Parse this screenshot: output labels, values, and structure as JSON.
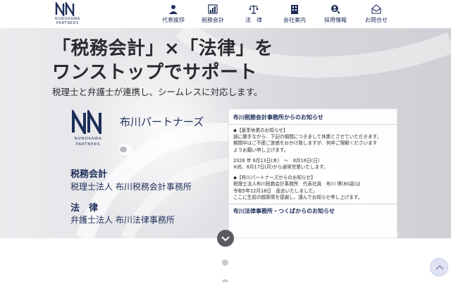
{
  "header": {
    "logo_line1": "NUNOKAWA",
    "logo_line2": "PARTNERS",
    "nav": [
      {
        "label": "代表挨拶",
        "icon": "person-icon"
      },
      {
        "label": "税務会計",
        "icon": "chart-icon"
      },
      {
        "label": "法　律",
        "icon": "scales-icon"
      },
      {
        "label": "会社案内",
        "icon": "building-icon"
      },
      {
        "label": "採用情報",
        "icon": "search-person-icon"
      },
      {
        "label": "お問合せ",
        "icon": "mail-icon"
      }
    ]
  },
  "hero": {
    "headline_line1": "「税務会計」×「法律」を",
    "headline_line2": "ワンストップでサポート",
    "subhead": "税理士と弁護士が連携し、シームレスに対応します。",
    "brand_name": "布川パートナーズ",
    "brand_logo_line1": "NUNOKAWA",
    "brand_logo_line2": "PARTNERS",
    "sections": [
      {
        "title": "税務会計",
        "sub": "税理士法人 布川税務会計事務所"
      },
      {
        "title": "法　律",
        "sub": "弁護士法人 布川法律事務所"
      }
    ]
  },
  "notice": {
    "heading": "布川税務会計事務所からのお知らせ",
    "item1_title": "◆【夏季休業のお知らせ】",
    "item1_lines": [
      "誠に勝手ながら、下記の期間につきまして休業とさせていただきます。",
      "期間中はご不便ご迷惑をおかけ致しますが、何卒ご理解くださいます",
      "ようお願い申し上げます。"
    ],
    "item1_dates": "2026 年 8月13日(木)　～　8月16日(日)",
    "item1_note": "※尚、8月17日(月)から通常営業いたします。",
    "item2_title": "◆【布川パートナーズからのお知らせ】",
    "item2_lines": [
      "税理士法人布川税務会計事務所　代表社員　布川 博(80歳)は",
      "令和5年12月18日　逝去いたしました。",
      "ここに生前の御厚情を感謝し、謹んでお知らせ申し上げます。"
    ],
    "heading2": "布川法律事務所・つくばからのお知らせ"
  },
  "colors": {
    "brand_navy": "#1f2f5a",
    "hero_bg": "#e2e2e6"
  }
}
